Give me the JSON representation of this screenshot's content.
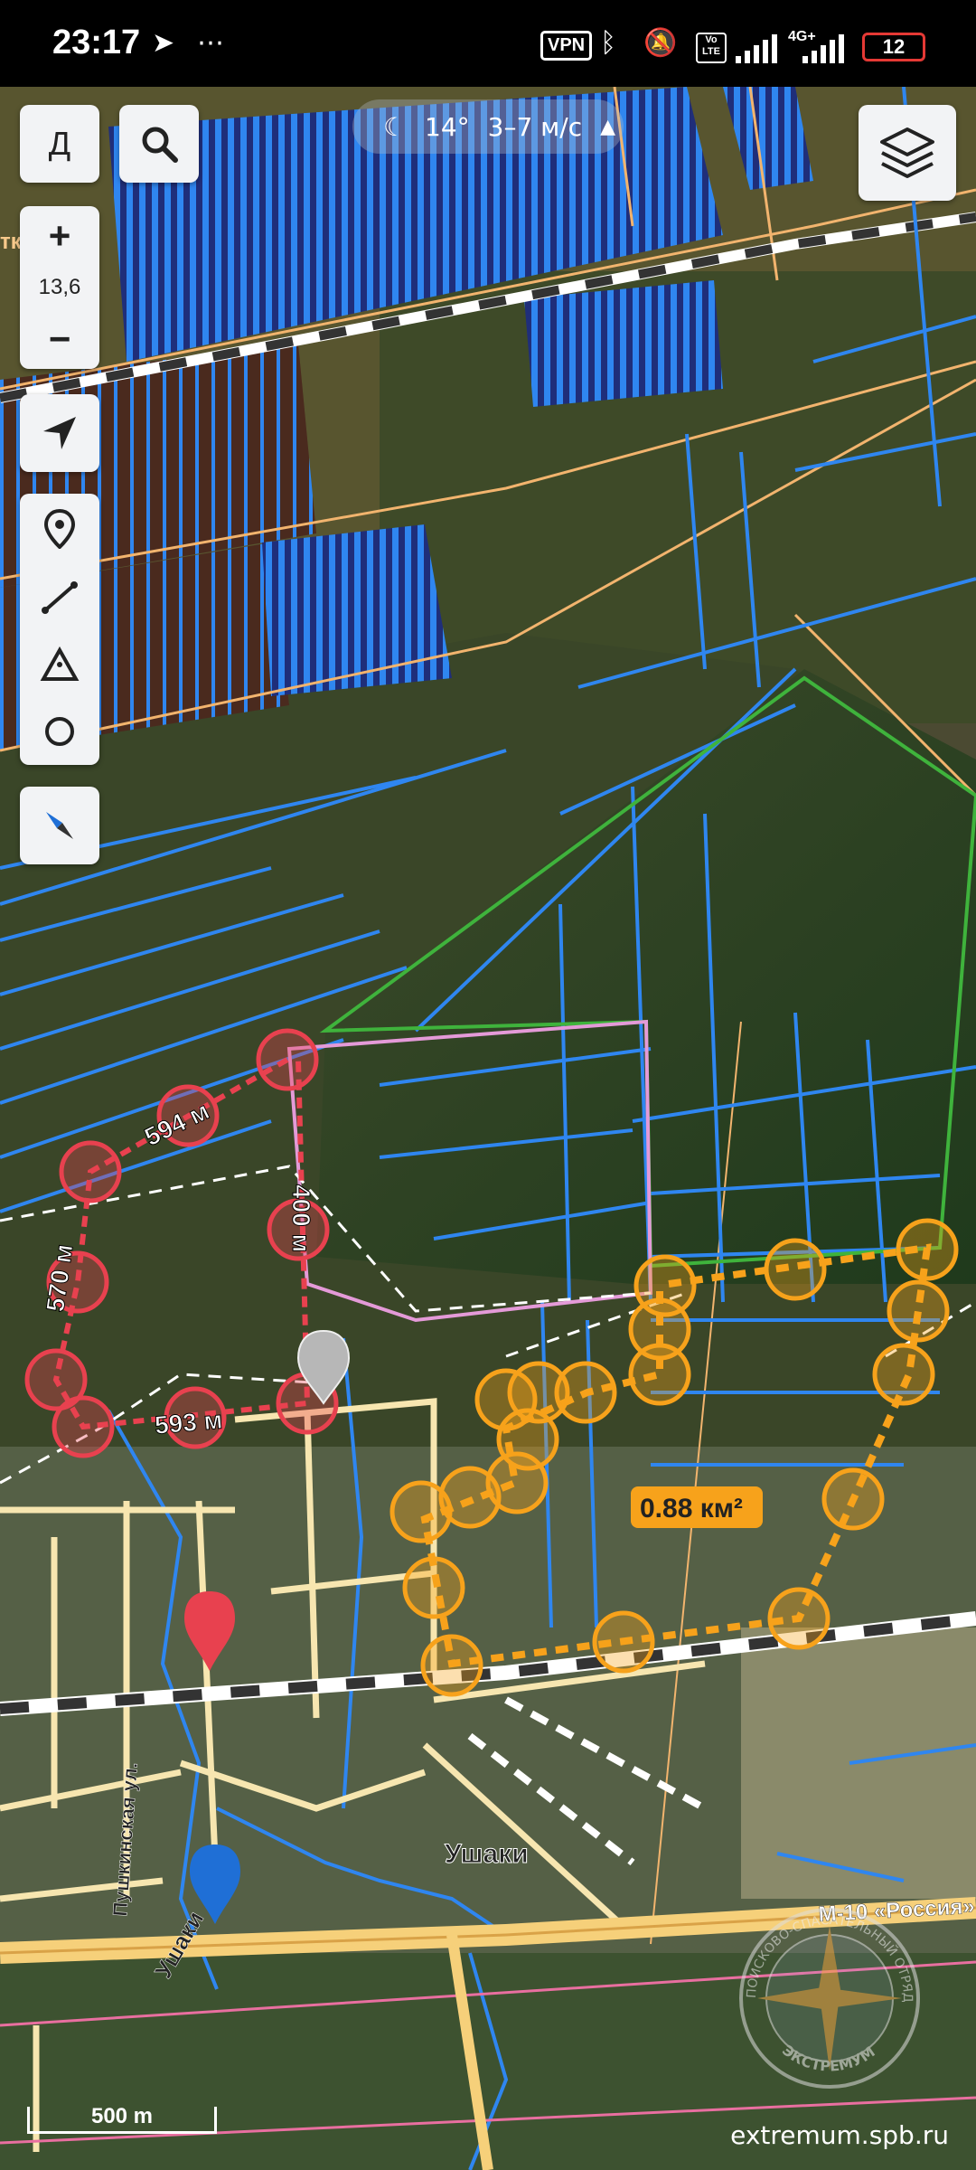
{
  "status": {
    "time": "23:17",
    "vpn": "VPN",
    "volte_top": "Vo",
    "volte_bottom": "LTE",
    "network": "4G+",
    "battery": "12"
  },
  "weather": {
    "temperature": "14°",
    "wind": "3–7 м/с"
  },
  "controls": {
    "d_label": "Д",
    "zoom_in": "+",
    "zoom_level": "13,6",
    "zoom_out": "−"
  },
  "map_labels": {
    "partial_top_left": "тки",
    "distance_1": "594 м",
    "distance_2": "570 м",
    "distance_3": "593 м",
    "distance_4": "400 м",
    "area": "0.88 км²",
    "village": "Ушаки",
    "street": "Пушкинская ул.",
    "ushaki_road": "Ушаки",
    "highway": "М-10 «Россия»"
  },
  "scale_bar": "500 m",
  "watermark": "extremum.spb.ru",
  "logo": {
    "arc_top": "ПОИСКОВО-СПАСАТЕЛЬНЫЙ ОТРЯД",
    "arc_bottom": "ЭКСТРЕМУМ"
  },
  "colors": {
    "drainage": "#2f86f0",
    "measure_red": "#e8414f",
    "area_orange": "#f7a21b",
    "land_border": "#f2b46e",
    "green_border": "#3fb33c",
    "pink_border": "#e49ad8"
  }
}
